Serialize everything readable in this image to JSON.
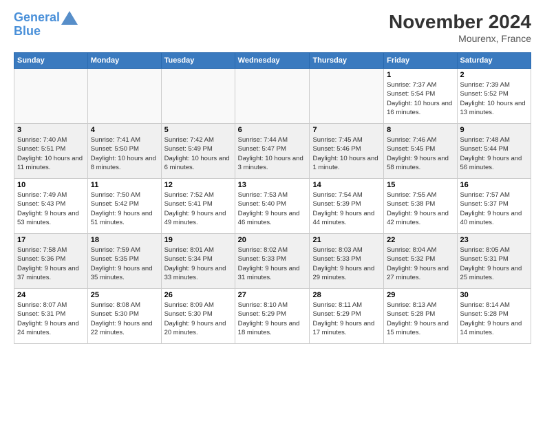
{
  "logo": {
    "line1": "General",
    "line2": "Blue"
  },
  "title": "November 2024",
  "subtitle": "Mourenx, France",
  "headers": [
    "Sunday",
    "Monday",
    "Tuesday",
    "Wednesday",
    "Thursday",
    "Friday",
    "Saturday"
  ],
  "weeks": [
    [
      {
        "day": "",
        "info": ""
      },
      {
        "day": "",
        "info": ""
      },
      {
        "day": "",
        "info": ""
      },
      {
        "day": "",
        "info": ""
      },
      {
        "day": "",
        "info": ""
      },
      {
        "day": "1",
        "info": "Sunrise: 7:37 AM\nSunset: 5:54 PM\nDaylight: 10 hours and 16 minutes."
      },
      {
        "day": "2",
        "info": "Sunrise: 7:39 AM\nSunset: 5:52 PM\nDaylight: 10 hours and 13 minutes."
      }
    ],
    [
      {
        "day": "3",
        "info": "Sunrise: 7:40 AM\nSunset: 5:51 PM\nDaylight: 10 hours and 11 minutes."
      },
      {
        "day": "4",
        "info": "Sunrise: 7:41 AM\nSunset: 5:50 PM\nDaylight: 10 hours and 8 minutes."
      },
      {
        "day": "5",
        "info": "Sunrise: 7:42 AM\nSunset: 5:49 PM\nDaylight: 10 hours and 6 minutes."
      },
      {
        "day": "6",
        "info": "Sunrise: 7:44 AM\nSunset: 5:47 PM\nDaylight: 10 hours and 3 minutes."
      },
      {
        "day": "7",
        "info": "Sunrise: 7:45 AM\nSunset: 5:46 PM\nDaylight: 10 hours and 1 minute."
      },
      {
        "day": "8",
        "info": "Sunrise: 7:46 AM\nSunset: 5:45 PM\nDaylight: 9 hours and 58 minutes."
      },
      {
        "day": "9",
        "info": "Sunrise: 7:48 AM\nSunset: 5:44 PM\nDaylight: 9 hours and 56 minutes."
      }
    ],
    [
      {
        "day": "10",
        "info": "Sunrise: 7:49 AM\nSunset: 5:43 PM\nDaylight: 9 hours and 53 minutes."
      },
      {
        "day": "11",
        "info": "Sunrise: 7:50 AM\nSunset: 5:42 PM\nDaylight: 9 hours and 51 minutes."
      },
      {
        "day": "12",
        "info": "Sunrise: 7:52 AM\nSunset: 5:41 PM\nDaylight: 9 hours and 49 minutes."
      },
      {
        "day": "13",
        "info": "Sunrise: 7:53 AM\nSunset: 5:40 PM\nDaylight: 9 hours and 46 minutes."
      },
      {
        "day": "14",
        "info": "Sunrise: 7:54 AM\nSunset: 5:39 PM\nDaylight: 9 hours and 44 minutes."
      },
      {
        "day": "15",
        "info": "Sunrise: 7:55 AM\nSunset: 5:38 PM\nDaylight: 9 hours and 42 minutes."
      },
      {
        "day": "16",
        "info": "Sunrise: 7:57 AM\nSunset: 5:37 PM\nDaylight: 9 hours and 40 minutes."
      }
    ],
    [
      {
        "day": "17",
        "info": "Sunrise: 7:58 AM\nSunset: 5:36 PM\nDaylight: 9 hours and 37 minutes."
      },
      {
        "day": "18",
        "info": "Sunrise: 7:59 AM\nSunset: 5:35 PM\nDaylight: 9 hours and 35 minutes."
      },
      {
        "day": "19",
        "info": "Sunrise: 8:01 AM\nSunset: 5:34 PM\nDaylight: 9 hours and 33 minutes."
      },
      {
        "day": "20",
        "info": "Sunrise: 8:02 AM\nSunset: 5:33 PM\nDaylight: 9 hours and 31 minutes."
      },
      {
        "day": "21",
        "info": "Sunrise: 8:03 AM\nSunset: 5:33 PM\nDaylight: 9 hours and 29 minutes."
      },
      {
        "day": "22",
        "info": "Sunrise: 8:04 AM\nSunset: 5:32 PM\nDaylight: 9 hours and 27 minutes."
      },
      {
        "day": "23",
        "info": "Sunrise: 8:05 AM\nSunset: 5:31 PM\nDaylight: 9 hours and 25 minutes."
      }
    ],
    [
      {
        "day": "24",
        "info": "Sunrise: 8:07 AM\nSunset: 5:31 PM\nDaylight: 9 hours and 24 minutes."
      },
      {
        "day": "25",
        "info": "Sunrise: 8:08 AM\nSunset: 5:30 PM\nDaylight: 9 hours and 22 minutes."
      },
      {
        "day": "26",
        "info": "Sunrise: 8:09 AM\nSunset: 5:30 PM\nDaylight: 9 hours and 20 minutes."
      },
      {
        "day": "27",
        "info": "Sunrise: 8:10 AM\nSunset: 5:29 PM\nDaylight: 9 hours and 18 minutes."
      },
      {
        "day": "28",
        "info": "Sunrise: 8:11 AM\nSunset: 5:29 PM\nDaylight: 9 hours and 17 minutes."
      },
      {
        "day": "29",
        "info": "Sunrise: 8:13 AM\nSunset: 5:28 PM\nDaylight: 9 hours and 15 minutes."
      },
      {
        "day": "30",
        "info": "Sunrise: 8:14 AM\nSunset: 5:28 PM\nDaylight: 9 hours and 14 minutes."
      }
    ]
  ]
}
